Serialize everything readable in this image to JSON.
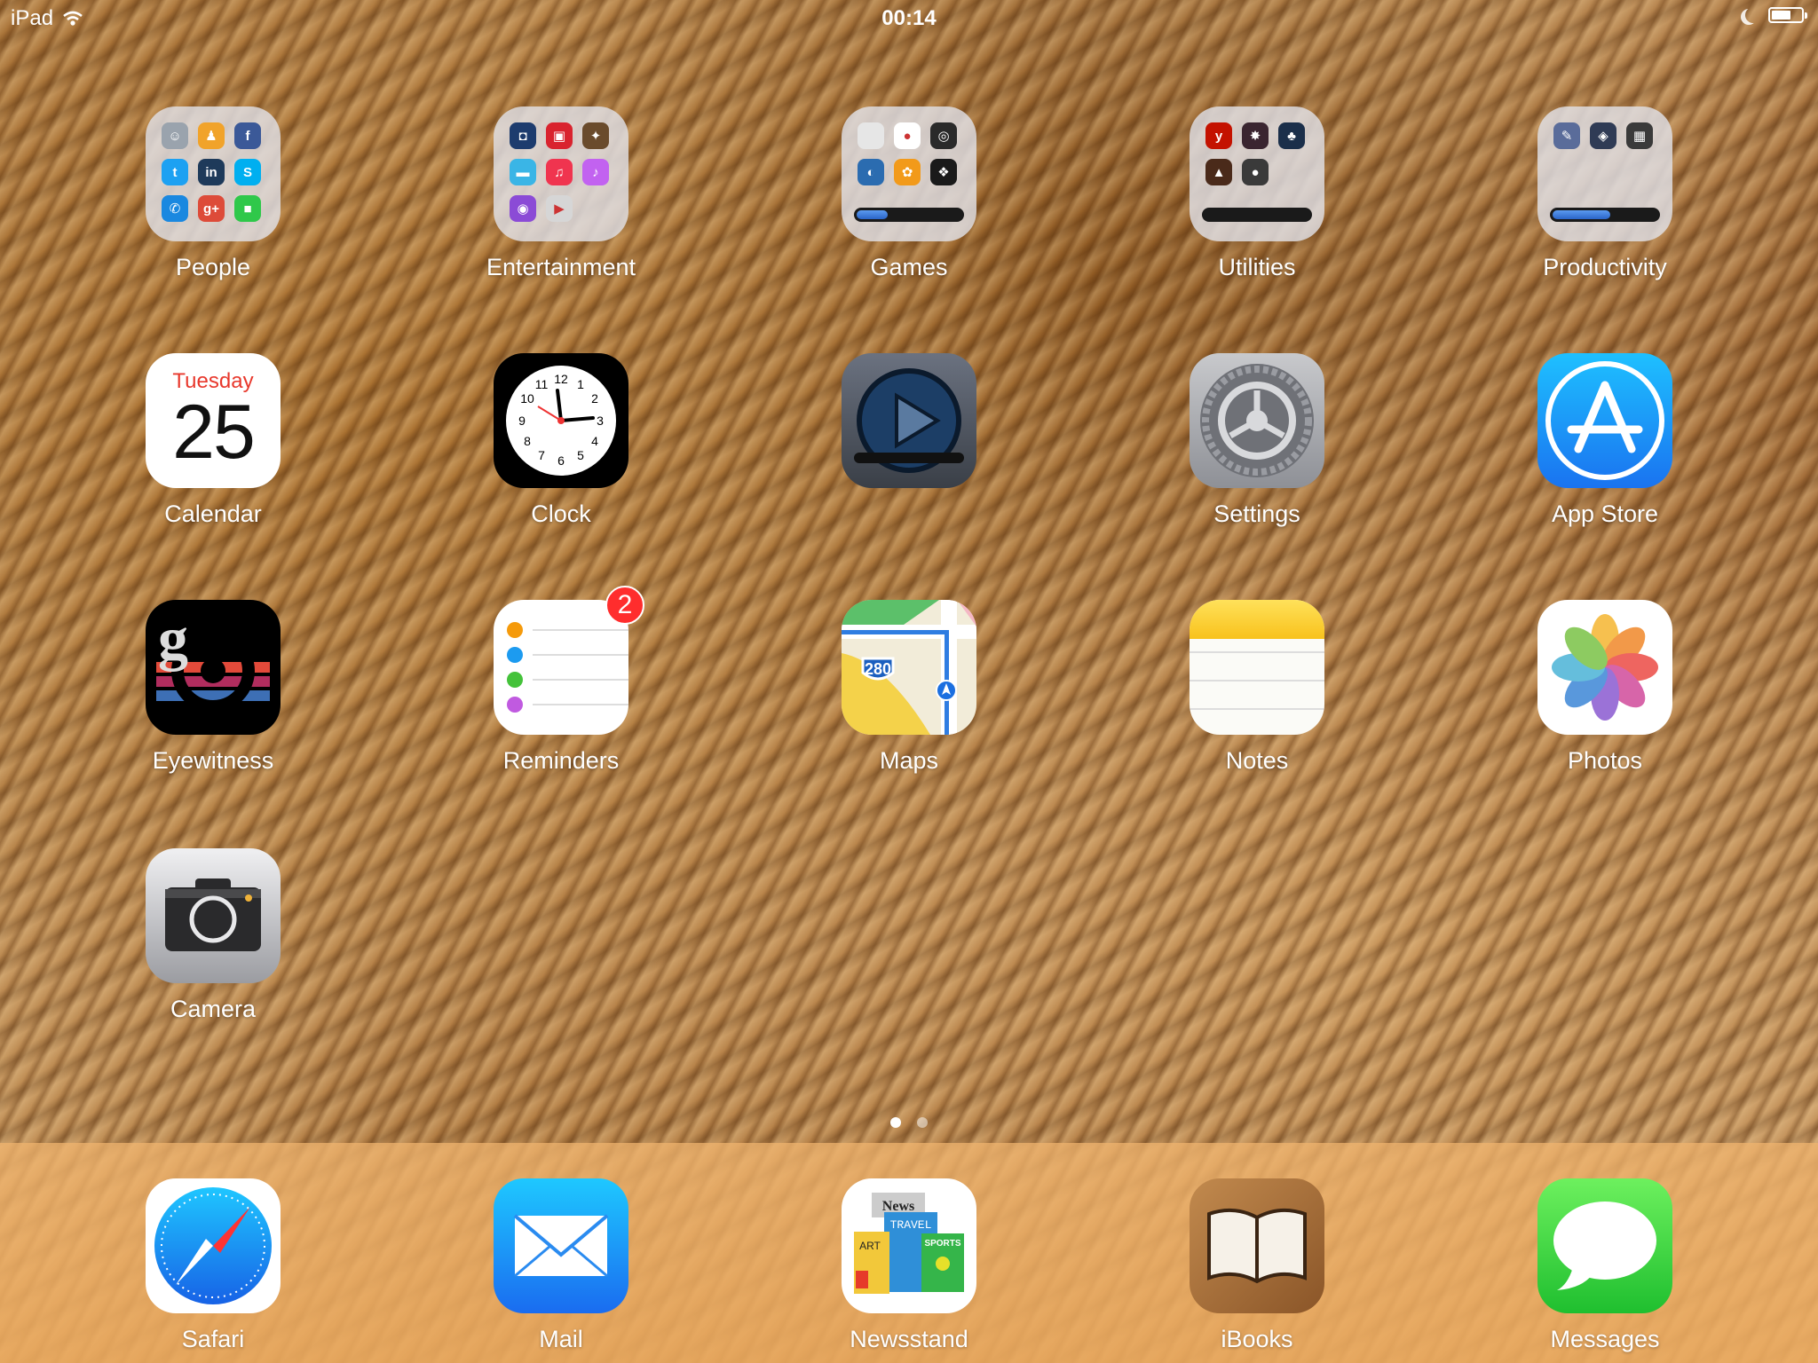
{
  "status": {
    "device": "iPad",
    "time": "00:14",
    "battery_percent": 65
  },
  "folders": [
    {
      "name": "People",
      "minis": [
        {
          "icon": "contacts-icon",
          "color": "#9aa3ad",
          "glyph": "☺"
        },
        {
          "icon": "find-friends-icon",
          "color": "#f1a32a",
          "glyph": "♟"
        },
        {
          "icon": "facebook-icon",
          "color": "#3b5998",
          "glyph": "f"
        },
        {
          "icon": "twitter-icon",
          "color": "#1da1f2",
          "glyph": "t"
        },
        {
          "icon": "linkedin-icon",
          "color": "#1e3a5a",
          "glyph": "in"
        },
        {
          "icon": "skype-icon",
          "color": "#00aff0",
          "glyph": "S"
        },
        {
          "icon": "phone-icon",
          "color": "#1a88e0",
          "glyph": "✆"
        },
        {
          "icon": "google-plus-icon",
          "color": "#dd4b39",
          "glyph": "g+"
        },
        {
          "icon": "facetime-icon",
          "color": "#2fc84a",
          "glyph": "■"
        }
      ]
    },
    {
      "name": "Entertainment",
      "minis": [
        {
          "icon": "camera-app-icon",
          "color": "#1d3c6e",
          "glyph": "◘"
        },
        {
          "icon": "photo-booth-icon",
          "color": "#d9232e",
          "glyph": "▣"
        },
        {
          "icon": "movie-icon",
          "color": "#6a4b2c",
          "glyph": "✦"
        },
        {
          "icon": "videos-icon",
          "color": "#3ab5e6",
          "glyph": "▬"
        },
        {
          "icon": "itunes-store-icon",
          "color": "#f0344f",
          "glyph": "♫"
        },
        {
          "icon": "music-icon",
          "color": "#c262f0",
          "glyph": "♪"
        },
        {
          "icon": "podcasts-icon",
          "color": "#8b4bd6",
          "glyph": "◉"
        },
        {
          "icon": "youtube-icon",
          "color": "#d6d6d6",
          "glyph": "▶"
        }
      ]
    },
    {
      "name": "Games",
      "progress": 0.3,
      "minis": [
        {
          "icon": "game-center-icon",
          "color": "#e6e6e6",
          "glyph": ""
        },
        {
          "icon": "game-bubbles-icon",
          "color": "#ffffff",
          "glyph": "●"
        },
        {
          "icon": "steam-icon",
          "color": "#2a2a2a",
          "glyph": "◎"
        },
        {
          "icon": "game-droplet-icon",
          "color": "#2b6cb0",
          "glyph": "◐"
        },
        {
          "icon": "game-dog-icon",
          "color": "#f29a1a",
          "glyph": "✿"
        },
        {
          "icon": "game-dark-icon",
          "color": "#1a1a1a",
          "glyph": "❖"
        }
      ]
    },
    {
      "name": "Utilities",
      "progress": 0.0,
      "minis": [
        {
          "icon": "yelp-icon",
          "color": "#c41200",
          "glyph": "y"
        },
        {
          "icon": "utility-red-icon",
          "color": "#3a2530",
          "glyph": "✸"
        },
        {
          "icon": "utility-tree-icon",
          "color": "#1b2f4a",
          "glyph": "♣"
        },
        {
          "icon": "utility-brown-icon",
          "color": "#4a2a1a",
          "glyph": "▲"
        },
        {
          "icon": "utility-globe-icon",
          "color": "#3a3a3a",
          "glyph": "●"
        }
      ]
    },
    {
      "name": "Productivity",
      "progress": 0.55,
      "minis": [
        {
          "icon": "productivity-pen-icon",
          "color": "#5a6c9a",
          "glyph": "✎"
        },
        {
          "icon": "productivity-map-icon",
          "color": "#2f3b55",
          "glyph": "◈"
        },
        {
          "icon": "productivity-box-icon",
          "color": "#3a3a3a",
          "glyph": "▦"
        }
      ]
    }
  ],
  "apps_row2": [
    {
      "name": "Calendar",
      "weekday": "Tuesday",
      "day": "25"
    },
    {
      "name": "Clock"
    },
    {
      "name": ""
    },
    {
      "name": "Settings"
    },
    {
      "name": "App Store"
    }
  ],
  "apps_row3": [
    {
      "name": "Eyewitness"
    },
    {
      "name": "Reminders",
      "badge": "2"
    },
    {
      "name": "Maps",
      "shield": "280"
    },
    {
      "name": "Notes"
    },
    {
      "name": "Photos"
    }
  ],
  "apps_row4": [
    {
      "name": "Camera"
    }
  ],
  "dock": [
    {
      "name": "Safari"
    },
    {
      "name": "Mail"
    },
    {
      "name": "Newsstand",
      "words": [
        "News",
        "TRAVEL",
        "ART",
        "SPORTS"
      ]
    },
    {
      "name": "iBooks"
    },
    {
      "name": "Messages"
    }
  ],
  "page_dots": {
    "count": 2,
    "active": 0
  }
}
